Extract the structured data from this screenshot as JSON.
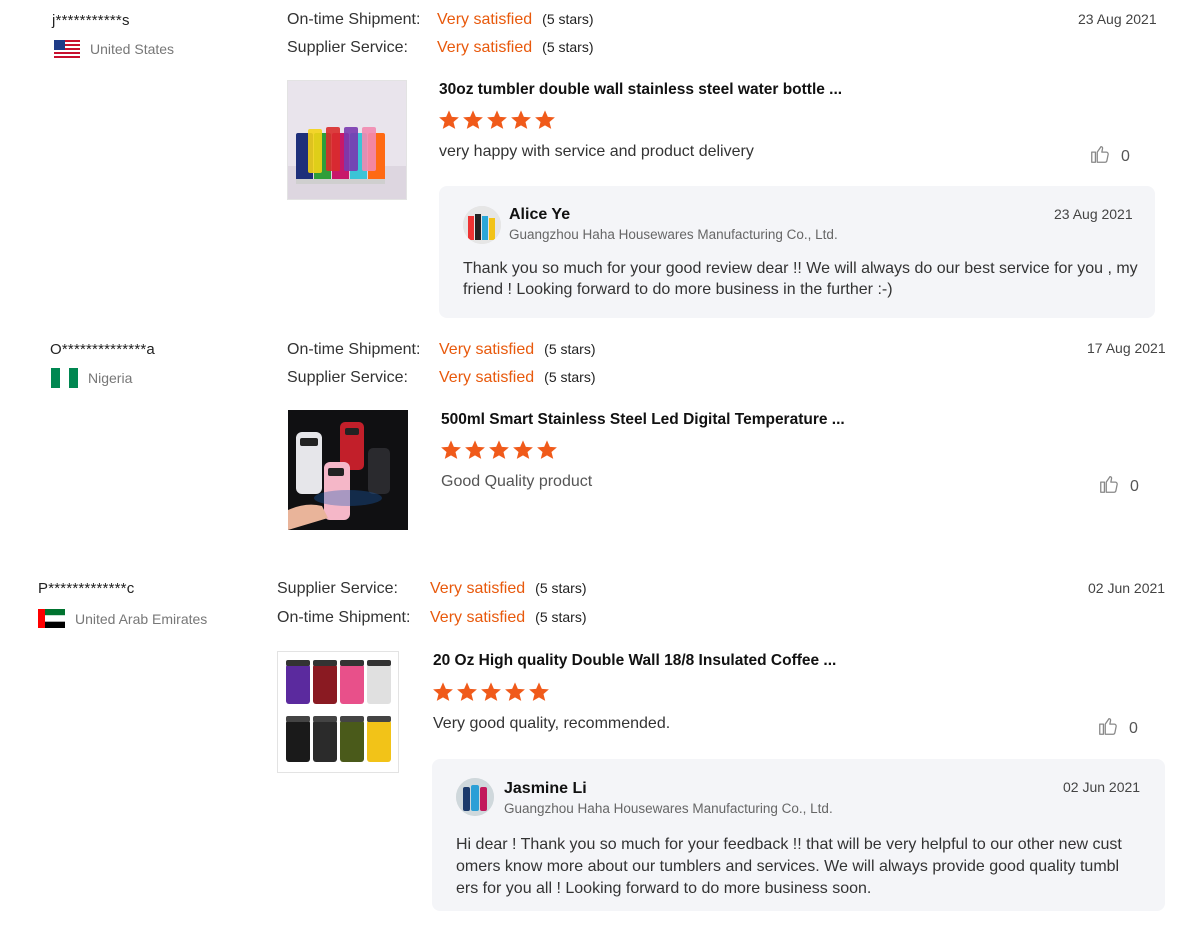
{
  "reviews": [
    {
      "buyer": "j***********s",
      "country": "United States",
      "flag_icon": "us-flag-icon",
      "ratings": [
        {
          "label": "On-time Shipment:",
          "value": "Very satisfied",
          "stars": "(5 stars)"
        },
        {
          "label": "Supplier Service:",
          "value": "Very satisfied",
          "stars": "(5 stars)"
        }
      ],
      "date": "23 Aug 2021",
      "product_title": "30oz tumbler double wall stainless steel water bottle ...",
      "product_rating": 5,
      "comment": "very happy with service and product delivery",
      "likes": "0",
      "reply": {
        "name": "Alice Ye",
        "company": "Guangzhou Haha Housewares Manufacturing Co., Ltd.",
        "date": "23 Aug 2021",
        "lines": [
          "Thank you so much for your good review dear !! We will always do our best service for you , my",
          "friend ! Looking forward to do more business in the further :-)"
        ]
      }
    },
    {
      "buyer": "O**************a",
      "country": "Nigeria",
      "flag_icon": "nigeria-flag-icon",
      "ratings": [
        {
          "label": "On-time Shipment:",
          "value": "Very satisfied",
          "stars": "(5 stars)"
        },
        {
          "label": "Supplier Service:",
          "value": "Very satisfied",
          "stars": "(5 stars)"
        }
      ],
      "date": "17 Aug 2021",
      "product_title": "500ml Smart Stainless Steel Led Digital Temperature ...",
      "product_rating": 5,
      "comment": "Good Quality product",
      "likes": "0"
    },
    {
      "buyer": "P*************c",
      "country": "United Arab Emirates",
      "flag_icon": "uae-flag-icon",
      "ratings": [
        {
          "label": "Supplier Service:",
          "value": "Very satisfied",
          "stars": "(5 stars)"
        },
        {
          "label": "On-time Shipment:",
          "value": "Very satisfied",
          "stars": "(5 stars)"
        }
      ],
      "date": "02 Jun 2021",
      "product_title": "20 Oz High quality Double Wall 18/8 Insulated Coffee ...",
      "product_rating": 5,
      "comment": "Very good quality, recommended.",
      "likes": "0",
      "reply": {
        "name": "Jasmine Li",
        "company": "Guangzhou Haha Housewares Manufacturing Co., Ltd.",
        "date": "02 Jun 2021",
        "lines": [
          "Hi dear ! Thank you so much for your feedback !! that will be very helpful to our other new cust",
          "omers know more about our tumblers and services. We will always provide good quality tumbl",
          "ers for you all ! Looking forward to do more business soon."
        ]
      }
    }
  ],
  "colors": {
    "accent": "#e8590c",
    "star": "#f05a1a",
    "reply_bg": "#f4f5f8"
  }
}
